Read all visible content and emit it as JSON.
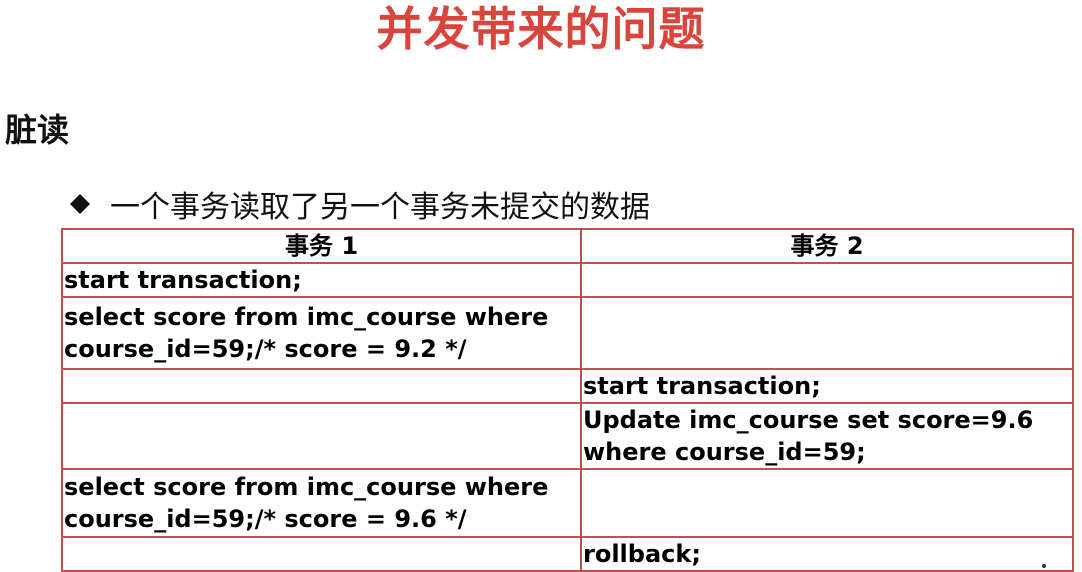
{
  "slide": {
    "title": "并发带来的问题",
    "subtitle": "脏读",
    "bullet": {
      "icon": "diamond-bullet-icon",
      "text": "一个事务读取了另一个事务未提交的数据"
    },
    "colors": {
      "title": "#d9443b",
      "table_border": "#c0504d",
      "text": "#000000"
    }
  },
  "table": {
    "headers": [
      "事务 1",
      "事务 2"
    ],
    "rows": [
      [
        "start transaction;",
        ""
      ],
      [
        "select score from imc_course where course_id=59;/* score = 9.2 */",
        ""
      ],
      [
        "",
        "start transaction;"
      ],
      [
        "",
        "Update imc_course set score=9.6 where course_id=59;"
      ],
      [
        "select score from imc_course where course_id=59;/* score = 9.6 */",
        ""
      ],
      [
        "",
        "rollback;"
      ]
    ]
  }
}
